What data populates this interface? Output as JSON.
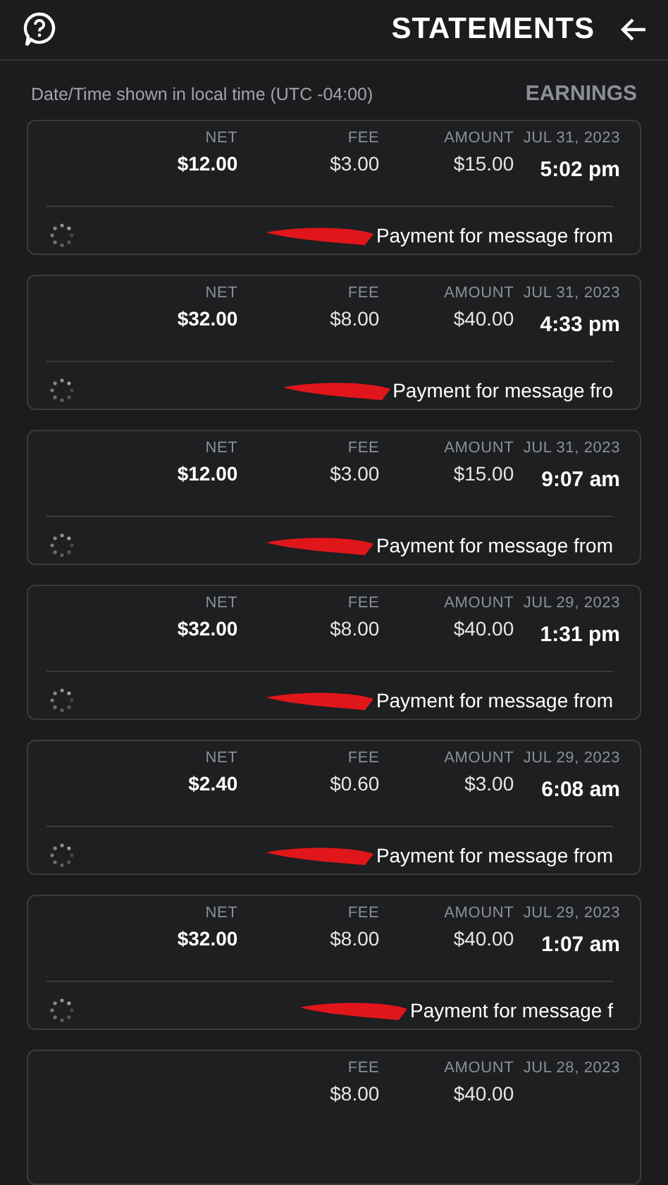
{
  "header": {
    "title": "STATEMENTS"
  },
  "section": {
    "title": "EARNINGS",
    "note": "Date/Time shown in local time (UTC -04:00)"
  },
  "entries": [
    {
      "date": "JUL 31, 2023",
      "time": "5:02 pm",
      "amount_label": "AMOUNT",
      "amount": "$15.00",
      "fee_label": "FEE",
      "fee": "$3.00",
      "net_label": "NET",
      "net": "$12.00",
      "description": "Payment for message from"
    },
    {
      "date": "JUL 31, 2023",
      "time": "4:33 pm",
      "amount_label": "AMOUNT",
      "amount": "$40.00",
      "fee_label": "FEE",
      "fee": "$8.00",
      "net_label": "NET",
      "net": "$32.00",
      "description": "Payment for message fro"
    },
    {
      "date": "JUL 31, 2023",
      "time": "9:07 am",
      "amount_label": "AMOUNT",
      "amount": "$15.00",
      "fee_label": "FEE",
      "fee": "$3.00",
      "net_label": "NET",
      "net": "$12.00",
      "description": "Payment for message from"
    },
    {
      "date": "JUL 29, 2023",
      "time": "1:31 pm",
      "amount_label": "AMOUNT",
      "amount": "$40.00",
      "fee_label": "FEE",
      "fee": "$8.00",
      "net_label": "NET",
      "net": "$32.00",
      "description": "Payment for message from"
    },
    {
      "date": "JUL 29, 2023",
      "time": "6:08 am",
      "amount_label": "AMOUNT",
      "amount": "$3.00",
      "fee_label": "FEE",
      "fee": "$0.60",
      "net_label": "NET",
      "net": "$2.40",
      "description": "Payment for message from"
    },
    {
      "date": "JUL 29, 2023",
      "time": "1:07 am",
      "amount_label": "AMOUNT",
      "amount": "$40.00",
      "fee_label": "FEE",
      "fee": "$8.00",
      "net_label": "NET",
      "net": "$32.00",
      "description": "Payment for message f"
    }
  ],
  "partial_entry": {
    "date": "JUL 28, 2023",
    "amount_label": "AMOUNT",
    "fee_label": "FEE",
    "amount": "$40.00",
    "fee": "$8.00"
  }
}
